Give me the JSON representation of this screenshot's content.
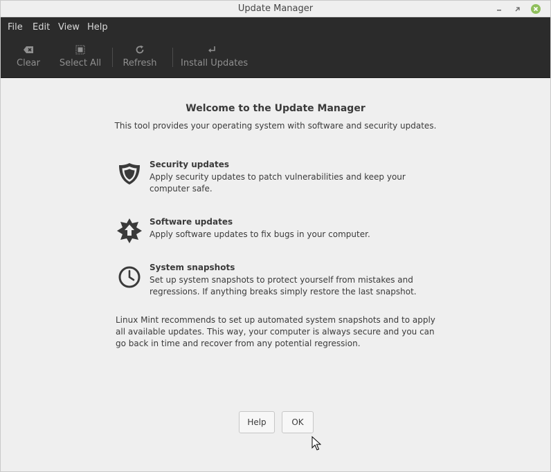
{
  "window": {
    "title": "Update Manager"
  },
  "menubar": {
    "items": [
      "File",
      "Edit",
      "View",
      "Help"
    ]
  },
  "toolbar": {
    "clear": {
      "label": "Clear",
      "icon": "backspace-icon"
    },
    "select_all": {
      "label": "Select All",
      "icon": "select-all-icon"
    },
    "refresh": {
      "label": "Refresh",
      "icon": "refresh-icon"
    },
    "install": {
      "label": "Install Updates",
      "icon": "enter-icon"
    }
  },
  "welcome": {
    "title": "Welcome to the Update Manager",
    "subtitle": "This tool provides your operating system with software and security updates."
  },
  "features": [
    {
      "icon": "shield-icon",
      "heading": "Security updates",
      "body": "Apply security updates to patch vulnerabilities and keep your computer safe."
    },
    {
      "icon": "upgrade-icon",
      "heading": "Software updates",
      "body": "Apply software updates to fix bugs in your computer."
    },
    {
      "icon": "clock-icon",
      "heading": "System snapshots",
      "body": "Set up system snapshots to protect yourself from mistakes and regressions. If anything breaks simply restore the last snapshot."
    }
  ],
  "recommendation": "Linux Mint recommends to set up automated system snapshots and to apply all available updates. This way, your computer is always secure and you can go back in time and recover from any potential regression.",
  "buttons": {
    "help": "Help",
    "ok": "OK"
  },
  "colors": {
    "close_button": "#8fbf5c",
    "toolbar_bg": "#2b2b2b",
    "content_bg": "#efefef"
  }
}
